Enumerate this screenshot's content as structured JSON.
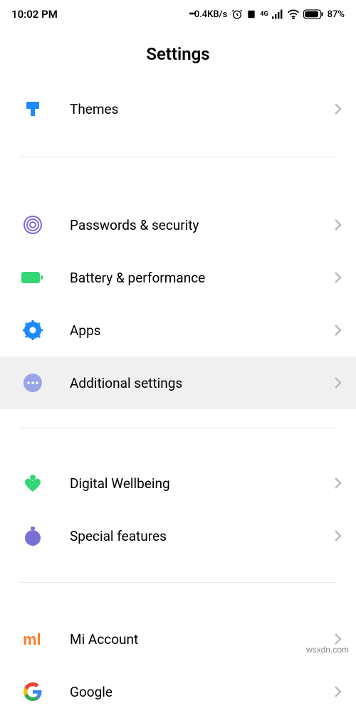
{
  "status": {
    "time": "10:02 PM",
    "net_speed": "0.4KB/s",
    "net_label": "4G",
    "battery": "87%"
  },
  "title": "Settings",
  "items": [
    {
      "id": "themes",
      "label": "Themes"
    },
    {
      "id": "passwords",
      "label": "Passwords & security"
    },
    {
      "id": "battery",
      "label": "Battery & performance"
    },
    {
      "id": "apps",
      "label": "Apps"
    },
    {
      "id": "additional",
      "label": "Additional settings"
    },
    {
      "id": "wellbeing",
      "label": "Digital Wellbeing"
    },
    {
      "id": "special",
      "label": "Special features"
    },
    {
      "id": "miaccount",
      "label": "Mi Account"
    },
    {
      "id": "google",
      "label": "Google"
    }
  ],
  "watermark": "wsxdn.com"
}
